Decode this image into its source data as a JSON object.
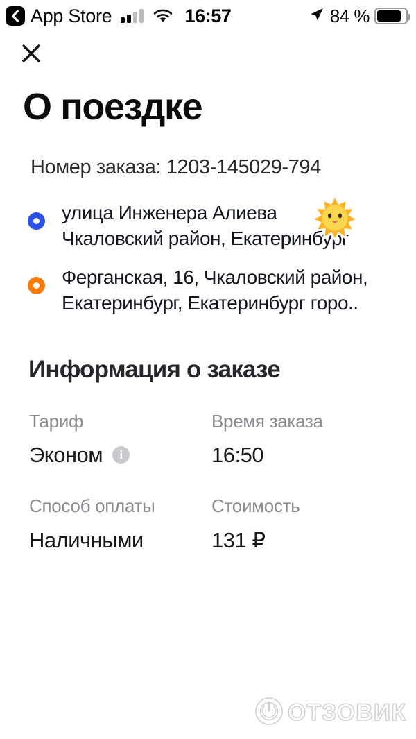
{
  "statusbar": {
    "back_label": "App Store",
    "back_icon": "chevron-left-icon",
    "signal_icon": "cellular-signal-icon",
    "wifi_icon": "wifi-icon",
    "time": "16:57",
    "location_icon": "location-arrow-icon",
    "battery_percent": "84 %",
    "battery_icon": "battery-icon",
    "battery_level": 84
  },
  "header": {
    "close_icon": "close-icon",
    "title": "О поездке"
  },
  "order": {
    "number_line": "Номер заказа: 1203-145029-794"
  },
  "route": {
    "pickup": {
      "marker": "pickup-dot-blue",
      "color": "#2b52e8",
      "text": "улица Инженера Алиева\nЧкаловский район, Екатеринбург"
    },
    "dropoff": {
      "marker": "dropoff-dot-orange",
      "color": "#f97a05",
      "text": "Ферганская, 16, Чкаловский район,\nЕкатеринбург, Екатеринбург горо.."
    },
    "sticker_icon": "sun-emoji"
  },
  "info": {
    "section_title": "Информация о заказе",
    "rows": [
      {
        "left": {
          "label": "Тариф",
          "value": "Эконом",
          "icon": "info-circle-icon"
        },
        "right": {
          "label": "Время заказа",
          "value": "16:50"
        }
      },
      {
        "left": {
          "label": "Способ оплаты",
          "value": "Наличными"
        },
        "right": {
          "label": "Стоимость",
          "value": "131 ₽"
        }
      }
    ]
  },
  "watermark": {
    "text": "ОТЗОВИК",
    "logo_icon": "power-circle-logo-icon"
  }
}
